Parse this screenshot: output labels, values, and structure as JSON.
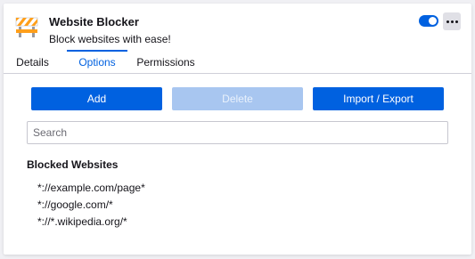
{
  "extension": {
    "name": "Website Blocker",
    "description": "Block websites with ease!",
    "icon": "roadblock-icon",
    "enabled": true
  },
  "tabs": [
    {
      "label": "Details",
      "active": false
    },
    {
      "label": "Options",
      "active": true
    },
    {
      "label": "Permissions",
      "active": false
    }
  ],
  "actions": {
    "add_label": "Add",
    "delete_label": "Delete",
    "import_export_label": "Import / Export"
  },
  "search": {
    "placeholder": "Search",
    "value": ""
  },
  "blocked": {
    "title": "Blocked Websites",
    "items": [
      "*://example.com/page*",
      "*://google.com/*",
      "*://*.wikipedia.org/*"
    ]
  },
  "colors": {
    "accent": "#0061e0",
    "disabled": "#a8c6f0"
  }
}
